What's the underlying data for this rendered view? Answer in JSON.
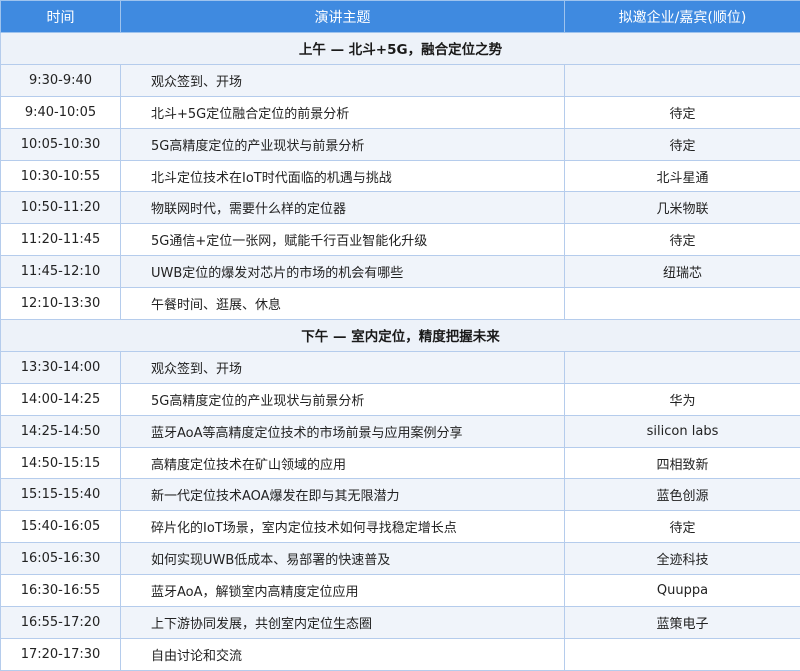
{
  "header": {
    "time": "时间",
    "topic": "演讲主题",
    "guest": "拟邀企业/嘉宾(顺位)"
  },
  "sections": [
    {
      "title": "上午 — 北斗+5G，融合定位之势",
      "rows": [
        {
          "time": "9:30-9:40",
          "topic": "观众签到、开场",
          "guest": ""
        },
        {
          "time": "9:40-10:05",
          "topic": "北斗+5G定位融合定位的前景分析",
          "guest": "待定"
        },
        {
          "time": "10:05-10:30",
          "topic": "5G高精度定位的产业现状与前景分析",
          "guest": "待定"
        },
        {
          "time": "10:30-10:55",
          "topic": "北斗定位技术在IoT时代面临的机遇与挑战",
          "guest": "北斗星通"
        },
        {
          "time": "10:50-11:20",
          "topic": "物联网时代，需要什么样的定位器",
          "guest": "几米物联"
        },
        {
          "time": "11:20-11:45",
          "topic": "5G通信+定位一张网，赋能千行百业智能化升级",
          "guest": "待定"
        },
        {
          "time": "11:45-12:10",
          "topic": "UWB定位的爆发对芯片的市场的机会有哪些",
          "guest": "纽瑞芯"
        },
        {
          "time": "12:10-13:30",
          "topic": "午餐时间、逛展、休息",
          "guest": ""
        }
      ]
    },
    {
      "title": "下午 — 室内定位，精度把握未来",
      "rows": [
        {
          "time": "13:30-14:00",
          "topic": "观众签到、开场",
          "guest": ""
        },
        {
          "time": "14:00-14:25",
          "topic": "5G高精度定位的产业现状与前景分析",
          "guest": "华为"
        },
        {
          "time": "14:25-14:50",
          "topic": "蓝牙AoA等高精度定位技术的市场前景与应用案例分享",
          "guest": "silicon labs"
        },
        {
          "time": "14:50-15:15",
          "topic": "高精度定位技术在矿山领域的应用",
          "guest": "四相致新"
        },
        {
          "time": "15:15-15:40",
          "topic": "新一代定位技术AOA爆发在即与其无限潜力",
          "guest": "蓝色创源"
        },
        {
          "time": "15:40-16:05",
          "topic": "碎片化的IoT场景，室内定位技术如何寻找稳定增长点",
          "guest": "待定"
        },
        {
          "time": "16:05-16:30",
          "topic": "如何实现UWB低成本、易部署的快速普及",
          "guest": "全迹科技"
        },
        {
          "time": "16:30-16:55",
          "topic": "蓝牙AoA，解锁室内高精度定位应用",
          "guest": "Quuppa"
        },
        {
          "time": "16:55-17:20",
          "topic": "上下游协同发展，共创室内定位生态圈",
          "guest": "蓝策电子"
        },
        {
          "time": "17:20-17:30",
          "topic": "自由讨论和交流",
          "guest": ""
        }
      ]
    }
  ]
}
